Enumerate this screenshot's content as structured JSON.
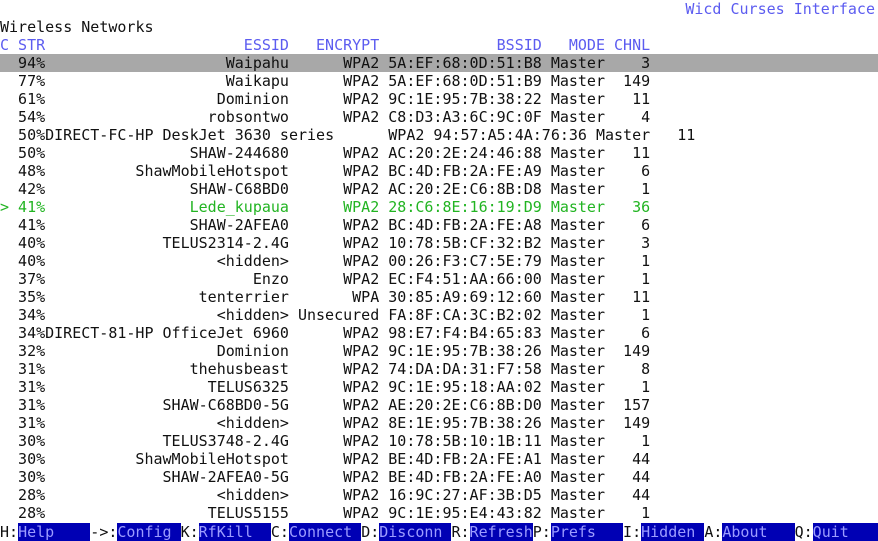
{
  "app_title": "Wicd Curses Interface",
  "section_title": "Wireless Networks",
  "colors": {
    "header": "#5c5cf0",
    "selected_row": "#a8a8a8",
    "connected_row": "#22b422",
    "footer_label_bg": "#0000b4",
    "footer_label_text": "#9c9cff"
  },
  "columns": {
    "c": "C",
    "str": "STR",
    "essid": "ESSID",
    "encrypt": "ENCRYPT",
    "bssid": "BSSID",
    "mode": "MODE",
    "chnl": "CHNL"
  },
  "networks": [
    {
      "c": "",
      "str": "94%",
      "essid": "Waipahu",
      "encrypt": "WPA2",
      "bssid": "5A:EF:68:0D:51:B8",
      "mode": "Master",
      "chnl": "3",
      "selected": true
    },
    {
      "c": "",
      "str": "77%",
      "essid": "Waikapu",
      "encrypt": "WPA2",
      "bssid": "5A:EF:68:0D:51:B9",
      "mode": "Master",
      "chnl": "149"
    },
    {
      "c": "",
      "str": "61%",
      "essid": "Dominion",
      "encrypt": "WPA2",
      "bssid": "9C:1E:95:7B:38:22",
      "mode": "Master",
      "chnl": "11"
    },
    {
      "c": "",
      "str": "54%",
      "essid": "robsontwo",
      "encrypt": "WPA2",
      "bssid": "C8:D3:A3:6C:9C:0F",
      "mode": "Master",
      "chnl": "4"
    },
    {
      "c": "",
      "str": "50%",
      "essid": "DIRECT-FC-HP DeskJet 3630 series",
      "encrypt": "WPA2",
      "bssid": "94:57:A5:4A:76:36",
      "mode": "Master",
      "chnl": "11"
    },
    {
      "c": "",
      "str": "50%",
      "essid": "SHAW-244680",
      "encrypt": "WPA2",
      "bssid": "AC:20:2E:24:46:88",
      "mode": "Master",
      "chnl": "11"
    },
    {
      "c": "",
      "str": "48%",
      "essid": "ShawMobileHotspot",
      "encrypt": "WPA2",
      "bssid": "BC:4D:FB:2A:FE:A9",
      "mode": "Master",
      "chnl": "6"
    },
    {
      "c": "",
      "str": "42%",
      "essid": "SHAW-C68BD0",
      "encrypt": "WPA2",
      "bssid": "AC:20:2E:C6:8B:D8",
      "mode": "Master",
      "chnl": "1"
    },
    {
      "c": ">",
      "str": "41%",
      "essid": "Lede_kupaua",
      "encrypt": "WPA2",
      "bssid": "28:C6:8E:16:19:D9",
      "mode": "Master",
      "chnl": "36",
      "connected": true
    },
    {
      "c": "",
      "str": "41%",
      "essid": "SHAW-2AFEA0",
      "encrypt": "WPA2",
      "bssid": "BC:4D:FB:2A:FE:A8",
      "mode": "Master",
      "chnl": "6"
    },
    {
      "c": "",
      "str": "40%",
      "essid": "TELUS2314-2.4G",
      "encrypt": "WPA2",
      "bssid": "10:78:5B:CF:32:B2",
      "mode": "Master",
      "chnl": "3"
    },
    {
      "c": "",
      "str": "40%",
      "essid": "<hidden>",
      "encrypt": "WPA2",
      "bssid": "00:26:F3:C7:5E:79",
      "mode": "Master",
      "chnl": "1"
    },
    {
      "c": "",
      "str": "37%",
      "essid": "Enzo",
      "encrypt": "WPA2",
      "bssid": "EC:F4:51:AA:66:00",
      "mode": "Master",
      "chnl": "1"
    },
    {
      "c": "",
      "str": "35%",
      "essid": "tenterrier",
      "encrypt": "WPA",
      "bssid": "30:85:A9:69:12:60",
      "mode": "Master",
      "chnl": "11"
    },
    {
      "c": "",
      "str": "34%",
      "essid": "<hidden>",
      "encrypt": "Unsecured",
      "bssid": "FA:8F:CA:3C:B2:02",
      "mode": "Master",
      "chnl": "1"
    },
    {
      "c": "",
      "str": "34%",
      "essid": "DIRECT-81-HP OfficeJet 6960",
      "encrypt": "WPA2",
      "bssid": "98:E7:F4:B4:65:83",
      "mode": "Master",
      "chnl": "6"
    },
    {
      "c": "",
      "str": "32%",
      "essid": "Dominion",
      "encrypt": "WPA2",
      "bssid": "9C:1E:95:7B:38:26",
      "mode": "Master",
      "chnl": "149"
    },
    {
      "c": "",
      "str": "31%",
      "essid": "thehusbeast",
      "encrypt": "WPA2",
      "bssid": "74:DA:DA:31:F7:58",
      "mode": "Master",
      "chnl": "8"
    },
    {
      "c": "",
      "str": "31%",
      "essid": "TELUS6325",
      "encrypt": "WPA2",
      "bssid": "9C:1E:95:18:AA:02",
      "mode": "Master",
      "chnl": "1"
    },
    {
      "c": "",
      "str": "31%",
      "essid": "SHAW-C68BD0-5G",
      "encrypt": "WPA2",
      "bssid": "AE:20:2E:C6:8B:D0",
      "mode": "Master",
      "chnl": "157"
    },
    {
      "c": "",
      "str": "31%",
      "essid": "<hidden>",
      "encrypt": "WPA2",
      "bssid": "8E:1E:95:7B:38:26",
      "mode": "Master",
      "chnl": "149"
    },
    {
      "c": "",
      "str": "30%",
      "essid": "TELUS3748-2.4G",
      "encrypt": "WPA2",
      "bssid": "10:78:5B:10:1B:11",
      "mode": "Master",
      "chnl": "1"
    },
    {
      "c": "",
      "str": "30%",
      "essid": "ShawMobileHotspot",
      "encrypt": "WPA2",
      "bssid": "BE:4D:FB:2A:FE:A1",
      "mode": "Master",
      "chnl": "44"
    },
    {
      "c": "",
      "str": "30%",
      "essid": "SHAW-2AFEA0-5G",
      "encrypt": "WPA2",
      "bssid": "BE:4D:FB:2A:FE:A0",
      "mode": "Master",
      "chnl": "44"
    },
    {
      "c": "",
      "str": "28%",
      "essid": "<hidden>",
      "encrypt": "WPA2",
      "bssid": "16:9C:27:AF:3B:D5",
      "mode": "Master",
      "chnl": "44"
    },
    {
      "c": "",
      "str": "28%",
      "essid": "TELUS5155",
      "encrypt": "WPA2",
      "bssid": "9C:1E:95:E4:43:82",
      "mode": "Master",
      "chnl": "1"
    }
  ],
  "footer": [
    {
      "key": "H:",
      "label": "Help"
    },
    {
      "key": "->:",
      "label": "Config"
    },
    {
      "key": "K:",
      "label": "RfKill"
    },
    {
      "key": "C:",
      "label": "Connect"
    },
    {
      "key": "D:",
      "label": "Disconn"
    },
    {
      "key": "R:",
      "label": "Refresh"
    },
    {
      "key": "P:",
      "label": "Prefs"
    },
    {
      "key": "I:",
      "label": "Hidden"
    },
    {
      "key": "A:",
      "label": "About"
    },
    {
      "key": "Q:",
      "label": "Quit"
    }
  ]
}
